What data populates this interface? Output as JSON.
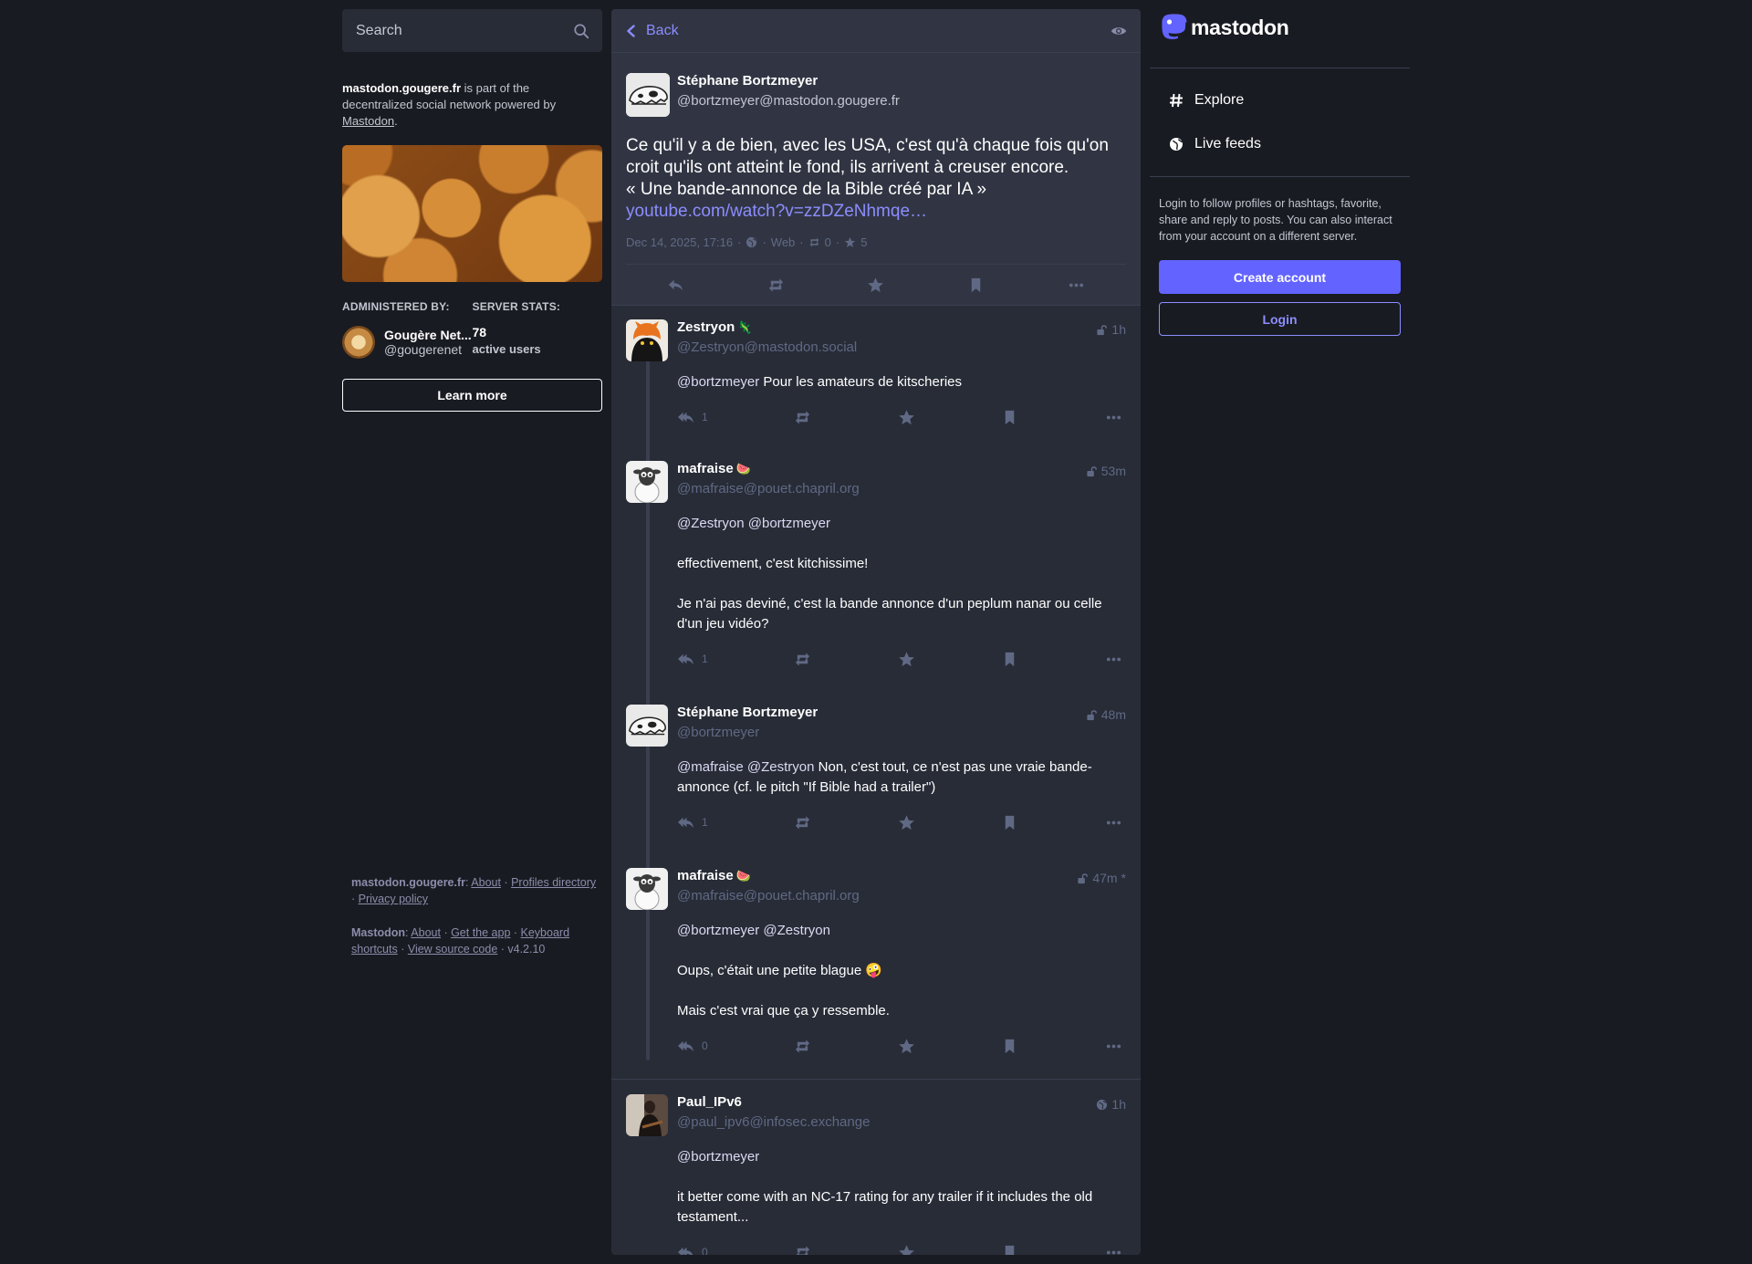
{
  "search": {
    "placeholder": "Search"
  },
  "server_about": {
    "domain": "mastodon.gougere.fr",
    "text": " is part of the decentralized social network powered by ",
    "link": "Mastodon",
    "end": "."
  },
  "admin": {
    "label": "Administered by:",
    "name": "Gougère Net...",
    "handle": "@gougerenet"
  },
  "stats": {
    "label": "Server stats:",
    "count": "78",
    "unit": "active users"
  },
  "learn_more": "Learn more",
  "footer": {
    "server_name": "mastodon.gougere.fr",
    "about": "About",
    "profiles_directory": "Profiles directory",
    "privacy_policy": "Privacy policy",
    "mastodon_name": "Mastodon",
    "mastodon_about": "About",
    "get_app": "Get the app",
    "keyboard_shortcuts": "Keyboard shortcuts",
    "source_code": "View source code",
    "version": "v4.2.10",
    "sep": " · ",
    "colon": ": "
  },
  "header": {
    "back": "Back"
  },
  "main_post": {
    "name": "Stéphane Bortzmeyer",
    "handle": "@bortzmeyer@mastodon.gougere.fr",
    "line1": "Ce qu'il y a de bien, avec les USA, c'est qu'à chaque fois qu'on croit qu'ils ont atteint le fond, ils arrivent à creuser encore.",
    "line2": "« Une bande-annonce de la Bible créé par IA »",
    "link": "youtube.com/watch?v=zzDZeNhmqe…",
    "date": "Dec 14, 2025, 17:16",
    "app": "Web",
    "boosts": "0",
    "favs": "5",
    "dot": "·"
  },
  "replies": [
    {
      "name": "Zestryon",
      "emoji": "🦎",
      "handle": "@Zestryon@mastodon.social",
      "time": "1h",
      "paragraphs": [
        {
          "mentions": "@bortzmeyer",
          "text": " Pour les amateurs de kitscheries"
        }
      ],
      "reply_count": "1"
    },
    {
      "name": "mafraise",
      "emoji": "🍉",
      "handle": "@mafraise@pouet.chapril.org",
      "time": "53m",
      "paragraphs": [
        {
          "mentions": "@Zestryon @bortzmeyer",
          "text": ""
        },
        {
          "mentions": "",
          "text": "effectivement, c'est kitchissime!"
        },
        {
          "mentions": "",
          "text": "Je n'ai pas deviné, c'est la bande annonce d'un peplum nanar ou celle d'un jeu vidéo?"
        }
      ],
      "reply_count": "1"
    },
    {
      "name": "Stéphane Bortzmeyer",
      "emoji": "",
      "handle": "@bortzmeyer",
      "time": "48m",
      "paragraphs": [
        {
          "mentions": "@mafraise @Zestryon",
          "text": " Non, c'est tout, ce n'est pas une vraie bande-annonce (cf. le pitch \"If Bible had a trailer\")"
        }
      ],
      "reply_count": "1"
    },
    {
      "name": "mafraise",
      "emoji": "🍉",
      "handle": "@mafraise@pouet.chapril.org",
      "time": "47m",
      "edited_mark": "*",
      "paragraphs": [
        {
          "mentions": "@bortzmeyer @Zestryon",
          "text": ""
        },
        {
          "mentions": "",
          "text": "Oups, c'était une petite blague 🤪"
        },
        {
          "mentions": "",
          "text": "Mais c'est vrai que ça y ressemble."
        }
      ],
      "reply_count": "0"
    },
    {
      "name": "Paul_IPv6",
      "emoji": "",
      "handle": "@paul_ipv6@infosec.exchange",
      "time": "1h",
      "paragraphs": [
        {
          "mentions": "@bortzmeyer",
          "text": ""
        },
        {
          "mentions": "",
          "text": "it better come with an NC-17 rating for any trailer if it includes the old testament..."
        }
      ],
      "reply_count": "0"
    }
  ],
  "right": {
    "logo": "mastodon",
    "explore": "Explore",
    "live_feeds": "Live feeds",
    "signup_text": "Login to follow profiles or hashtags, favorite, share and reply to posts. You can also interact from your account on a different server.",
    "create_account": "Create account",
    "login": "Login"
  },
  "colors": {
    "background": "#191b22",
    "panel": "#282c37",
    "accent": "#6364ff",
    "link": "#8c8dff",
    "muted": "#606984"
  }
}
